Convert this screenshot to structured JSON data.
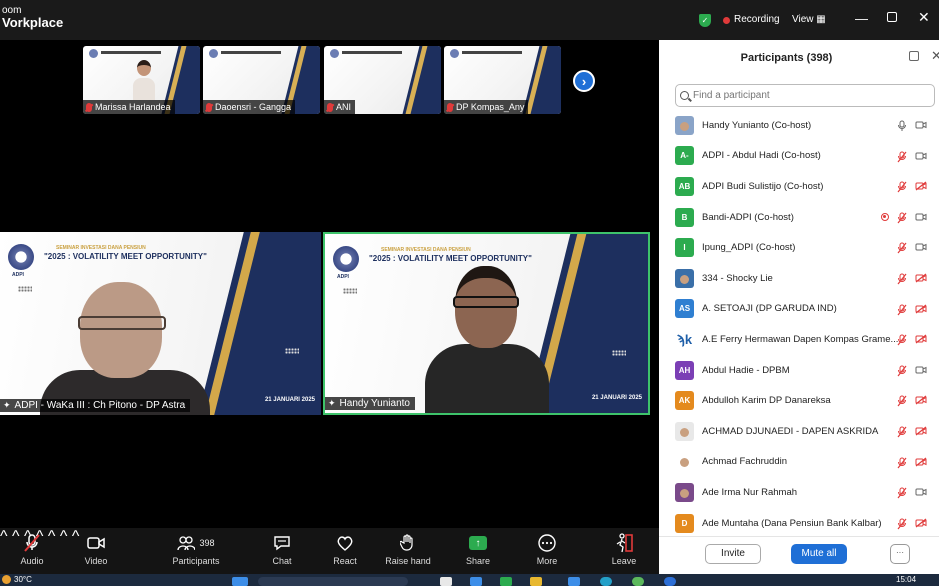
{
  "app": {
    "title_line1": "oom",
    "title_line2": "Vorkplace"
  },
  "topbar": {
    "recording_label": "Recording",
    "view_label": "View",
    "minimize_symbol": "—",
    "close_symbol": "✕"
  },
  "gallery": {
    "thumbnails": [
      {
        "name": "Marissa Harlandea"
      },
      {
        "name": "Daoensri - Gangga"
      },
      {
        "name": "ANI"
      },
      {
        "name": "DP Kompas_Any"
      }
    ],
    "next_symbol": "›"
  },
  "slide": {
    "seminar_label": "SEMINAR INVESTASI DANA PENSIUN",
    "theme": "\"2025 : VOLATILITY MEET OPPORTUNITY\"",
    "org": "ADPI",
    "date": "21 JANUARI 2025"
  },
  "videos": [
    {
      "name": "ADPI - WaKa III : Ch Pitono - DP Astra"
    },
    {
      "name": "Handy Yunianto"
    }
  ],
  "toolbar": {
    "audio": "Audio",
    "video": "Video",
    "participants": "Participants",
    "participants_count": "398",
    "chat": "Chat",
    "react": "React",
    "raise_hand": "Raise hand",
    "share": "Share",
    "more": "More",
    "leave": "Leave"
  },
  "panel": {
    "title": "Participants (398)",
    "search_placeholder": "Find a participant",
    "participants": [
      {
        "name": "Handy Yunianto (Co-host)",
        "initials": "",
        "color": "#8aa4c8",
        "mic": "on",
        "cam": "on",
        "photo": true
      },
      {
        "name": "ADPI - Abdul Hadi (Co-host)",
        "initials": "A-",
        "color": "#2cab4f",
        "mic": "muted",
        "cam": "on"
      },
      {
        "name": "ADPI Budi Sulistijo (Co-host)",
        "initials": "AB",
        "color": "#2cab4f",
        "mic": "muted",
        "cam": "off"
      },
      {
        "name": "Bandi-ADPI (Co-host)",
        "initials": "B",
        "color": "#2cab4f",
        "mic": "muted",
        "cam": "on",
        "recording": true
      },
      {
        "name": "Ipung_ADPI (Co-host)",
        "initials": "I",
        "color": "#2cab4f",
        "mic": "muted",
        "cam": "on"
      },
      {
        "name": "334 - Shocky Lie",
        "initials": "",
        "color": "#3a6fa8",
        "mic": "muted",
        "cam": "off",
        "photo": true
      },
      {
        "name": "A. SETOAJI (DP GARUDA IND)",
        "initials": "AS",
        "color": "#2f7fd1",
        "mic": "muted",
        "cam": "off"
      },
      {
        "name": "A.E Ferry Hermawan Dapen Kompas Grame...",
        "initials": "ϡk",
        "color": "#ffffff",
        "text_color": "#1f5fa8",
        "mic": "muted",
        "cam": "off"
      },
      {
        "name": "Abdul Hadie - DPBM",
        "initials": "AH",
        "color": "#7b3fb5",
        "mic": "muted",
        "cam": "on"
      },
      {
        "name": "Abdulloh Karim DP Danareksa",
        "initials": "AK",
        "color": "#e48a1e",
        "mic": "muted",
        "cam": "off"
      },
      {
        "name": "ACHMAD DJUNAEDI - DAPEN ASKRIDA",
        "initials": "",
        "color": "#e8e8e8",
        "mic": "muted",
        "cam": "off",
        "photo": true
      },
      {
        "name": "Achmad Fachruddin",
        "initials": "",
        "color": "#ffffff",
        "mic": "muted",
        "cam": "off",
        "photo": true
      },
      {
        "name": "Ade Irma Nur Rahmah",
        "initials": "",
        "color": "#7a4a8a",
        "mic": "muted",
        "cam": "on",
        "photo": true
      },
      {
        "name": "Ade Muntaha (Dana Pensiun Bank Kalbar)",
        "initials": "D",
        "color": "#e48a1e",
        "mic": "muted",
        "cam": "off"
      }
    ],
    "invite_label": "Invite",
    "mute_all_label": "Mute all",
    "more_symbol": "···"
  },
  "taskbar": {
    "weather": "30°C",
    "clock": "15:04"
  },
  "colors": {
    "accent": "#1f6fd6",
    "recording": "#e03a3a",
    "active_speaker": "#3ec36b",
    "slide_navy": "#1d2f5e",
    "slide_gold": "#d3a84a"
  },
  "icons": [
    "shield-icon",
    "mic-muted-icon",
    "camera-icon",
    "participants-icon",
    "chat-icon",
    "react-icon",
    "raise-hand-icon",
    "share-icon",
    "more-icon",
    "leave-icon",
    "search-icon",
    "popout-icon"
  ]
}
